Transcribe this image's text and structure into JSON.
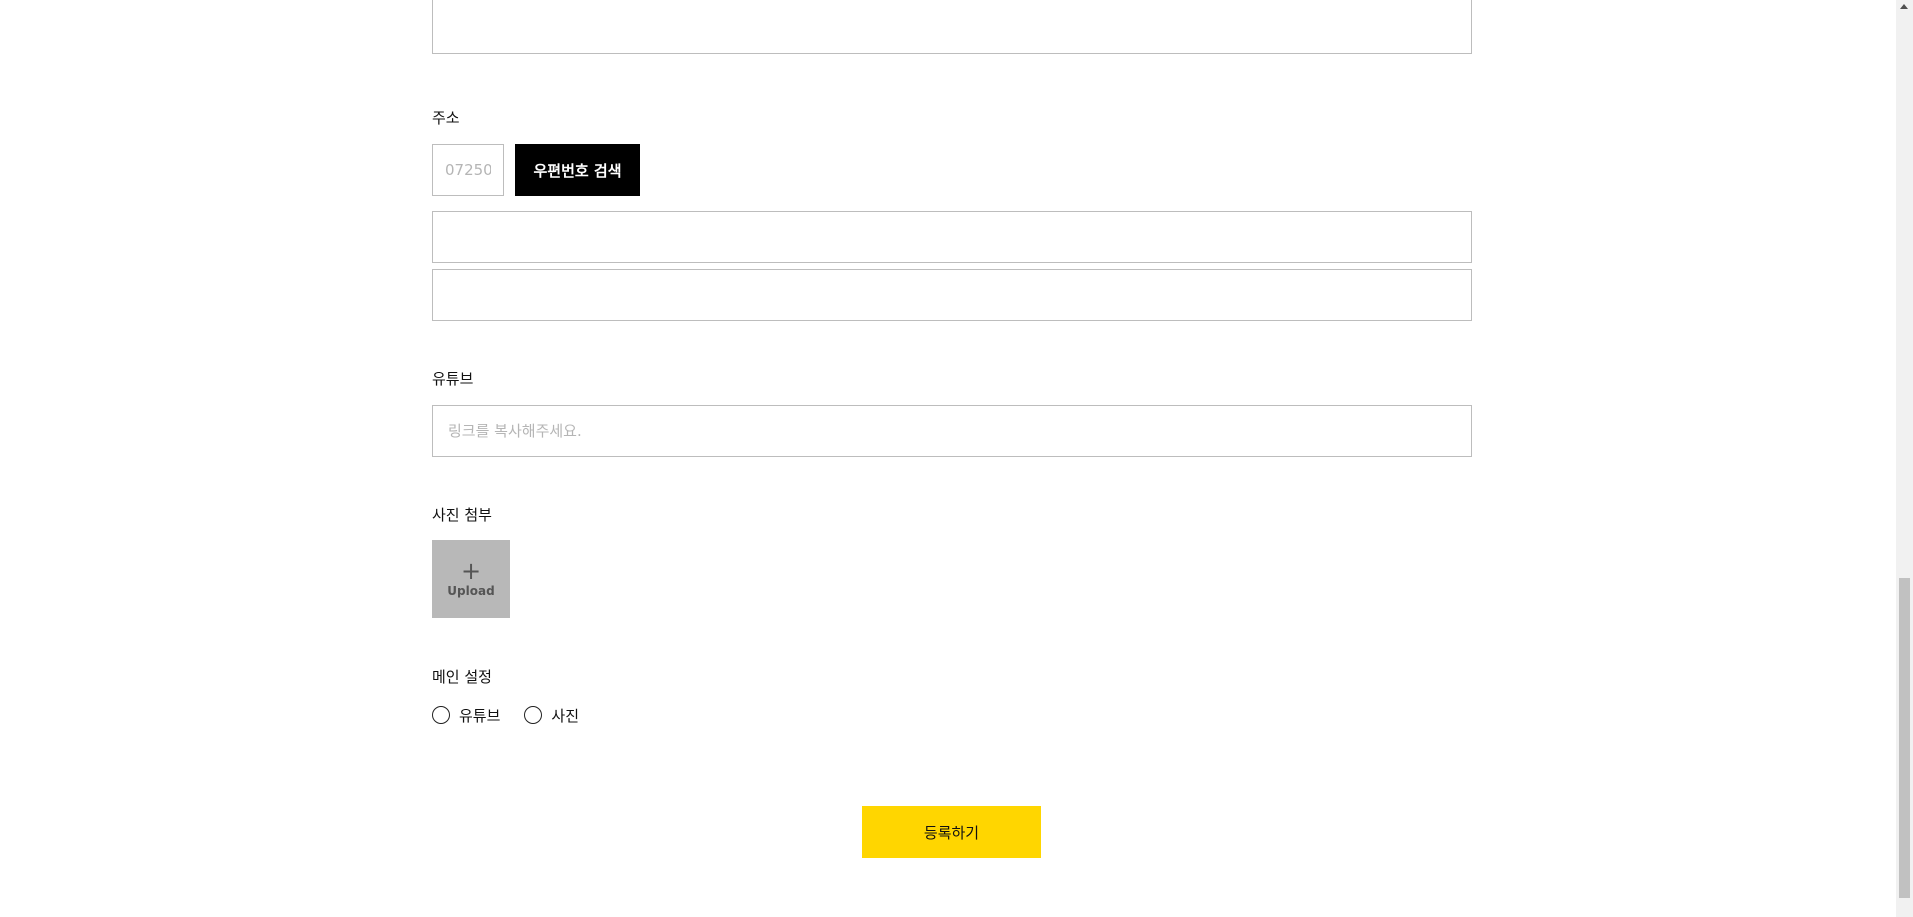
{
  "address": {
    "label": "주소",
    "zip_placeholder": "07250",
    "zip_button_label": "우편번호 검색"
  },
  "youtube": {
    "label": "유튜브",
    "placeholder": "링크를 복사해주세요."
  },
  "photo": {
    "label": "사진 첨부",
    "upload_plus": "+",
    "upload_label": "Upload"
  },
  "main_setting": {
    "label": "메인 설정",
    "options": [
      "유튜브",
      "사진"
    ]
  },
  "submit_label": "등록하기",
  "colors": {
    "submit_bg": "#ffd600",
    "zip_button_bg": "#000000",
    "upload_bg": "#b8b8b8",
    "border": "#bdbdbd"
  }
}
